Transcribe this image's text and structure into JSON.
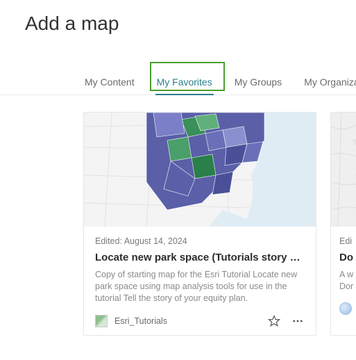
{
  "header": {
    "title": "Add a map"
  },
  "tabs": {
    "items": [
      {
        "label": "My Content"
      },
      {
        "label": "My Favorites"
      },
      {
        "label": "My Groups"
      },
      {
        "label": "My Organization"
      }
    ],
    "activeIndex": 1
  },
  "cards": [
    {
      "edited": "Edited: August 14, 2024",
      "title": "Locate new park space (Tutorials story …",
      "description": "Copy of starting map for the Esri Tutorial Locate new park space using map analysis tools for use in the tutorial Tell the story of your equity plan.",
      "owner": "Esri_Tutorials"
    },
    {
      "edited": "Edi",
      "title": "Do",
      "description": "A w\nDor",
      "owner": ""
    }
  ]
}
